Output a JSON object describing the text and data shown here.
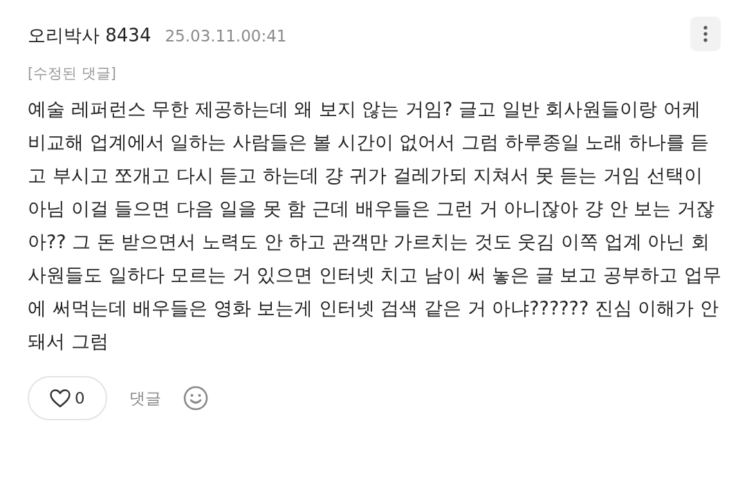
{
  "comment": {
    "author": "오리박사 8434",
    "timestamp": "25.03.11.00:41",
    "edited_label": "[수정된 댓글]",
    "body": "예술 레퍼런스 무한 제공하는데 왜 보지 않는 거임? 글고 일반 회사원들이랑 어케 비교해 업계에서 일하는 사람들은 볼 시간이 없어서 그럼 하루종일 노래 하나를 듣고 부시고 쪼개고 다시 듣고 하는데 걍 귀가 걸레가되 지쳐서 못 듣는 거임 선택이 아님 이걸 들으면 다음 일을 못 함 근데 배우들은 그런 거 아니잖아 걍 안 보는 거잖아?? 그 돈 받으면서 노력도 안 하고 관객만 가르치는 것도 웃김 이쪽 업계 아닌 회사원들도 일하다 모르는 거 있으면 인터넷 치고 남이 써 놓은 글 보고 공부하고 업무에 써먹는데 배우들은 영화 보는게 인터넷 검색 같은 거 아냐?????? 진심 이해가 안 돼서 그럼",
    "like": {
      "count": "0",
      "liked": false
    },
    "reply_label": "댓글"
  }
}
